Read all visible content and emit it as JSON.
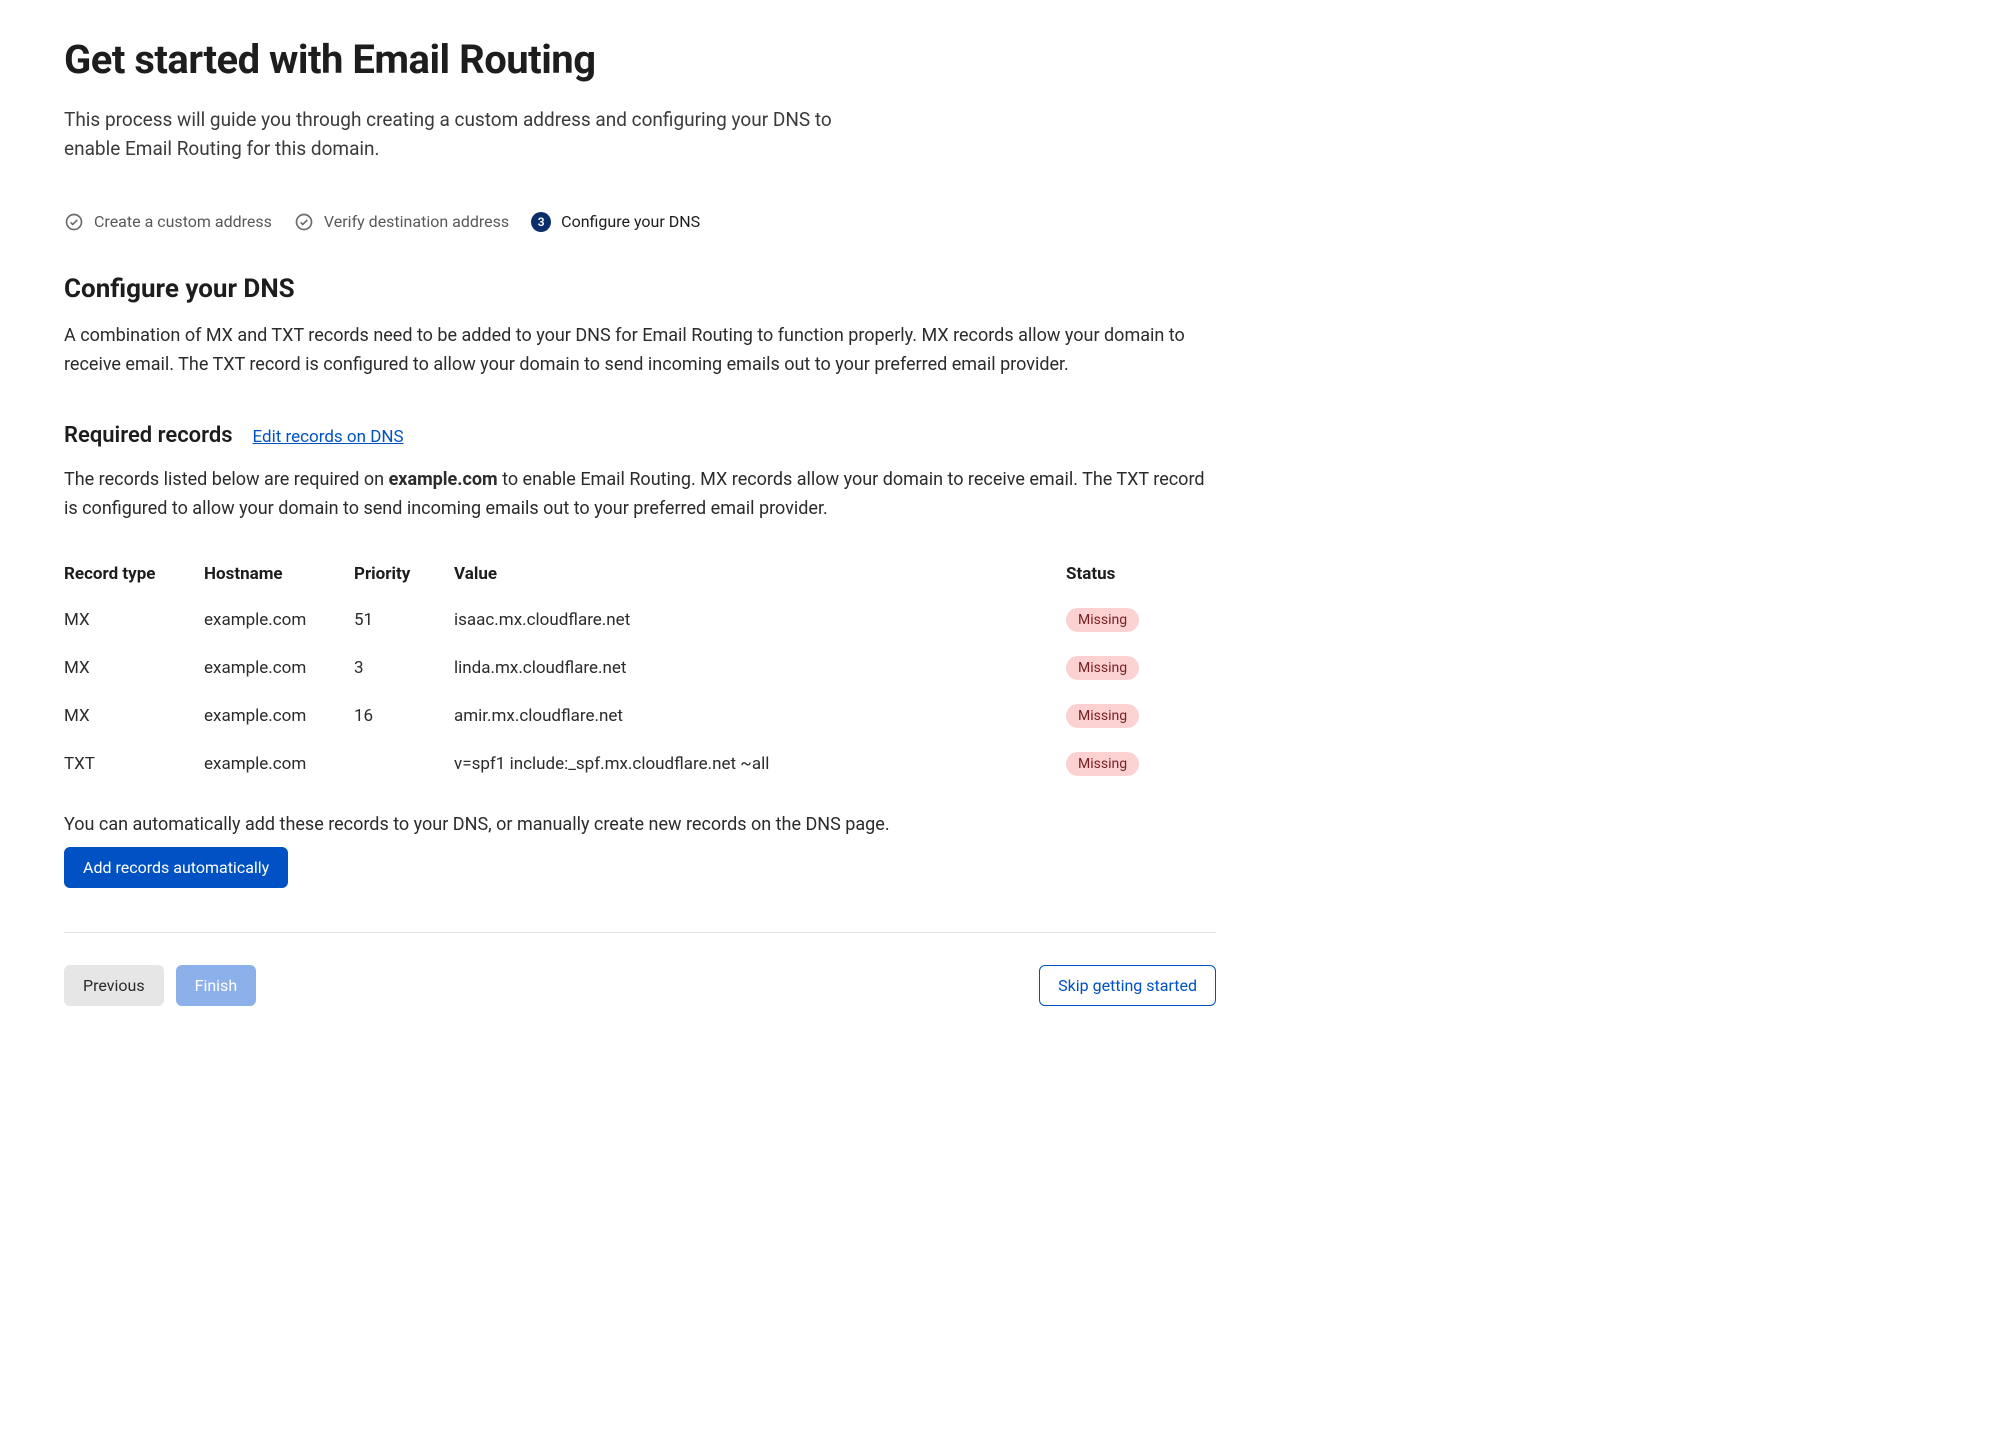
{
  "page": {
    "title": "Get started with Email Routing",
    "lead": "This process will guide you through creating a custom address and configuring your DNS to enable Email Routing for this domain."
  },
  "steps": [
    {
      "label": "Create a custom address",
      "complete": true,
      "current": false,
      "num": "1"
    },
    {
      "label": "Verify destination address",
      "complete": true,
      "current": false,
      "num": "2"
    },
    {
      "label": "Configure your DNS",
      "complete": false,
      "current": true,
      "num": "3"
    }
  ],
  "section": {
    "heading": "Configure your DNS",
    "description": "A combination of MX and TXT records need to be added to your DNS for Email Routing to function properly. MX records allow your domain to receive email. The TXT record is configured to allow your domain to send incoming emails out to your preferred email provider."
  },
  "required": {
    "heading": "Required records",
    "edit_link": "Edit records on DNS",
    "desc_prefix": "The records listed below are required on ",
    "domain": "example.com",
    "desc_suffix": " to enable Email Routing. MX records allow your domain to receive email. The TXT record is configured to allow your domain to send incoming emails out to your preferred email provider."
  },
  "table": {
    "headers": {
      "type": "Record type",
      "hostname": "Hostname",
      "priority": "Priority",
      "value": "Value",
      "status": "Status"
    },
    "rows": [
      {
        "type": "MX",
        "hostname": "example.com",
        "priority": "51",
        "value": "isaac.mx.cloudflare.net",
        "status": "Missing"
      },
      {
        "type": "MX",
        "hostname": "example.com",
        "priority": "3",
        "value": "linda.mx.cloudflare.net",
        "status": "Missing"
      },
      {
        "type": "MX",
        "hostname": "example.com",
        "priority": "16",
        "value": "amir.mx.cloudflare.net",
        "status": "Missing"
      },
      {
        "type": "TXT",
        "hostname": "example.com",
        "priority": "",
        "value": "v=spf1 include:_spf.mx.cloudflare.net ~all",
        "status": "Missing"
      }
    ]
  },
  "hint": "You can automatically add these records to your DNS, or manually create new records on the DNS page.",
  "buttons": {
    "add_auto": "Add records automatically",
    "previous": "Previous",
    "finish": "Finish",
    "skip": "Skip getting started"
  }
}
